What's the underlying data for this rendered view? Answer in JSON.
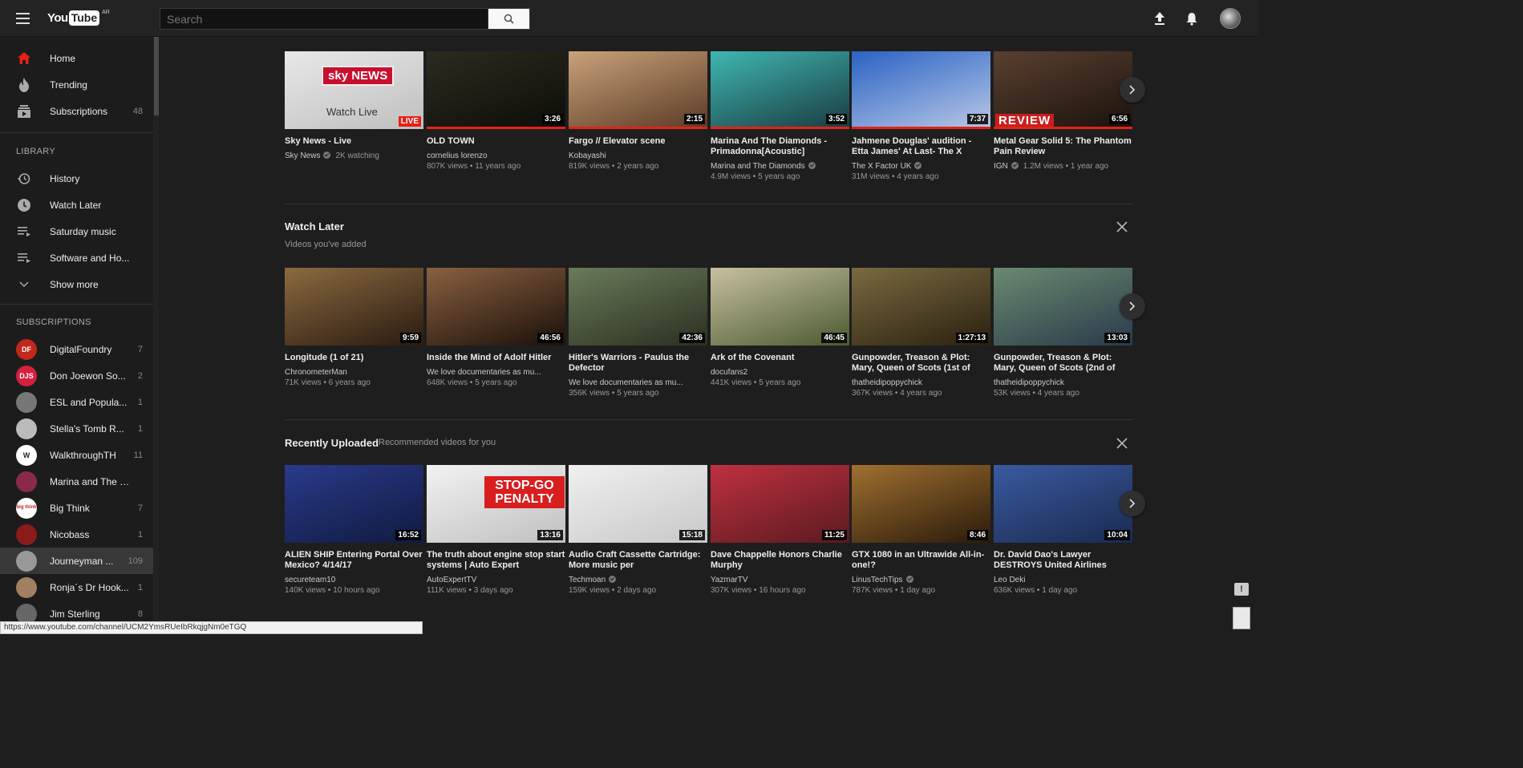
{
  "header": {
    "logo_you": "You",
    "logo_tube": "Tube",
    "logo_country": "AR",
    "search_placeholder": "Search"
  },
  "sidebar": {
    "main": [
      {
        "label": "Home",
        "icon": "home-icon"
      },
      {
        "label": "Trending",
        "icon": "flame-icon"
      },
      {
        "label": "Subscriptions",
        "icon": "subscriptions-icon",
        "count": "48"
      }
    ],
    "library_heading": "LIBRARY",
    "library": [
      {
        "label": "History",
        "icon": "history-icon"
      },
      {
        "label": "Watch Later",
        "icon": "clock-icon"
      },
      {
        "label": "Saturday music",
        "icon": "playlist-icon"
      },
      {
        "label": "Software and Ho...",
        "icon": "playlist-icon"
      },
      {
        "label": "Show more",
        "icon": "chevron-down-icon"
      }
    ],
    "subscriptions_heading": "SUBSCRIPTIONS",
    "subscriptions": [
      {
        "label": "DigitalFoundry",
        "count": "7",
        "avatar_text": "DF",
        "color": "#c0281e"
      },
      {
        "label": "Don Joewon So...",
        "count": "2",
        "avatar_text": "DJS",
        "color": "#d4213d"
      },
      {
        "label": "ESL and Popula...",
        "count": "1",
        "avatar_text": "",
        "color": "#777777"
      },
      {
        "label": "Stella's Tomb R...",
        "count": "1",
        "avatar_text": "",
        "color": "#bbbbbb"
      },
      {
        "label": "WalkthroughTH",
        "count": "11",
        "avatar_text": "W",
        "color": "#ffffff"
      },
      {
        "label": "Marina and The D...",
        "count": "",
        "avatar_text": "",
        "color": "#8a2a4a"
      },
      {
        "label": "Big Think",
        "count": "7",
        "avatar_text": "big think",
        "color": "#ffffff"
      },
      {
        "label": "Nicobass",
        "count": "1",
        "avatar_text": "",
        "color": "#8b1a1a"
      },
      {
        "label": "Journeyman ...",
        "count": "109",
        "avatar_text": "",
        "color": "#999999"
      },
      {
        "label": "Ronja´s Dr Hook...",
        "count": "1",
        "avatar_text": "",
        "color": "#a08060"
      },
      {
        "label": "Jim Sterling",
        "count": "8",
        "avatar_text": "",
        "color": "#666666"
      }
    ]
  },
  "shelves": [
    {
      "title": "",
      "subtitle": "",
      "videos": [
        {
          "title": "Sky News - Live",
          "channel": "Sky News",
          "verified": true,
          "meta_inline": "2K watching",
          "meta": "",
          "badge": "LIVE",
          "duration": "",
          "thumb_text": "sky NEWS",
          "thumb_sub": "Watch Live",
          "c1": "#e8e8e8",
          "c2": "#bfbfbf",
          "progress": 0
        },
        {
          "title": "OLD TOWN",
          "channel": "cornelius lorenzo",
          "verified": false,
          "meta": "807K views • 11 years ago",
          "duration": "3:26",
          "c1": "#2b2b1f",
          "c2": "#0d0d08",
          "progress": 1
        },
        {
          "title": "Fargo // Elevator scene",
          "channel": "Kobayashi",
          "verified": false,
          "meta": "819K views • 2 years ago",
          "duration": "2:15",
          "c1": "#c9a27a",
          "c2": "#5a3a25",
          "progress": 1
        },
        {
          "title": "Marina And The Diamonds - Primadonna[Acoustic]",
          "channel": "Marina and The Diamonds",
          "verified": true,
          "meta": "4.9M views • 5 years ago",
          "duration": "3:52",
          "c1": "#3fb7b2",
          "c2": "#1a3a40",
          "progress": 1
        },
        {
          "title": "Jahmene Douglas' audition - Etta James' At Last- The X",
          "channel": "The X Factor UK",
          "verified": true,
          "meta": "31M views • 4 years ago",
          "duration": "7:37",
          "c1": "#2a62c4",
          "c2": "#b8c8e6",
          "progress": 1
        },
        {
          "title": "Metal Gear Solid 5: The Phantom Pain Review",
          "channel": "IGN",
          "verified": true,
          "meta_inline": "1.2M views • 1 year ago",
          "meta": "",
          "duration": "6:56",
          "thumb_text": "REVIEW",
          "c1": "#5a4030",
          "c2": "#1a120c",
          "progress": 1
        }
      ]
    },
    {
      "title": "Watch Later",
      "subtitle": "Videos you've added",
      "videos": [
        {
          "title": "Longitude (1 of 21)",
          "channel": "ChronometerMan",
          "verified": false,
          "meta": "71K views • 6 years ago",
          "duration": "9:59",
          "c1": "#8a6a40",
          "c2": "#2a1a10",
          "progress": 0
        },
        {
          "title": "Inside the Mind of Adolf Hitler",
          "channel": "We love documentaries as mu...",
          "verified": false,
          "meta": "648K views • 5 years ago",
          "duration": "46:56",
          "c1": "#8a6040",
          "c2": "#1a100a",
          "progress": 0
        },
        {
          "title": "Hitler's Warriors - Paulus the Defector",
          "channel": "We love documentaries as mu...",
          "verified": false,
          "meta": "356K views • 5 years ago",
          "duration": "42:36",
          "c1": "#6a7a5a",
          "c2": "#2a3020",
          "progress": 0
        },
        {
          "title": "Ark of the Covenant",
          "channel": "docufans2",
          "verified": false,
          "meta": "441K views • 5 years ago",
          "duration": "46:45",
          "c1": "#c8c0a0",
          "c2": "#4a5a30",
          "progress": 0
        },
        {
          "title": "Gunpowder, Treason & Plot: Mary, Queen of Scots (1st of",
          "channel": "thatheidipoppychick",
          "verified": false,
          "meta": "367K views • 4 years ago",
          "duration": "1:27:13",
          "c1": "#7a6a40",
          "c2": "#2a2010",
          "progress": 0
        },
        {
          "title": "Gunpowder, Treason & Plot: Mary, Queen of Scots (2nd of",
          "channel": "thatheidipoppychick",
          "verified": false,
          "meta": "53K views • 4 years ago",
          "duration": "13:03",
          "c1": "#6a8a70",
          "c2": "#2a3a4a",
          "progress": 0
        }
      ]
    },
    {
      "title": "Recently Uploaded",
      "subtitle": "Recommended videos for you",
      "videos": [
        {
          "title": "ALIEN SHIP Entering Portal Over Mexico? 4/14/17",
          "channel": "secureteam10",
          "verified": false,
          "meta": "140K views • 10 hours ago",
          "duration": "16:52",
          "c1": "#2a3a8a",
          "c2": "#101a40",
          "progress": 0
        },
        {
          "title": "The truth about engine stop start systems | Auto Expert",
          "channel": "AutoExpertTV",
          "verified": false,
          "meta": "111K views • 3 days ago",
          "duration": "13:16",
          "thumb_text": "STOP-GO PENALTY",
          "c1": "#f2f2f2",
          "c2": "#c0c0c0",
          "progress": 0
        },
        {
          "title": "Audio Craft Cassette Cartridge: More music per",
          "channel": "Techmoan",
          "verified": true,
          "meta": "159K views • 2 days ago",
          "duration": "15:18",
          "c1": "#f0f0f0",
          "c2": "#c8c8c8",
          "progress": 0
        },
        {
          "title": "Dave Chappelle Honors Charlie Murphy",
          "channel": "YazmarTV",
          "verified": false,
          "meta": "307K views • 16 hours ago",
          "duration": "11:25",
          "c1": "#c03040",
          "c2": "#5a1a20",
          "progress": 0
        },
        {
          "title": "GTX 1080 in an Ultrawide All-in-one!?",
          "channel": "LinusTechTips",
          "verified": true,
          "meta": "787K views • 1 day ago",
          "duration": "8:46",
          "c1": "#a07030",
          "c2": "#2a1a0a",
          "progress": 0
        },
        {
          "title": "Dr. David Dao's Lawyer DESTROYS United Airlines",
          "channel": "Leo Deki",
          "verified": false,
          "meta": "636K views • 1 day ago",
          "duration": "10:04",
          "c1": "#3a5aa0",
          "c2": "#1a2a50",
          "progress": 0
        }
      ]
    }
  ],
  "statusbar": {
    "url": "https://www.youtube.com/channel/UCM2YmsRUeIbRkqjgNm0eTGQ"
  },
  "colors": {
    "accent_red": "#e62117",
    "background": "#1e1e1e",
    "masthead": "#232323"
  }
}
